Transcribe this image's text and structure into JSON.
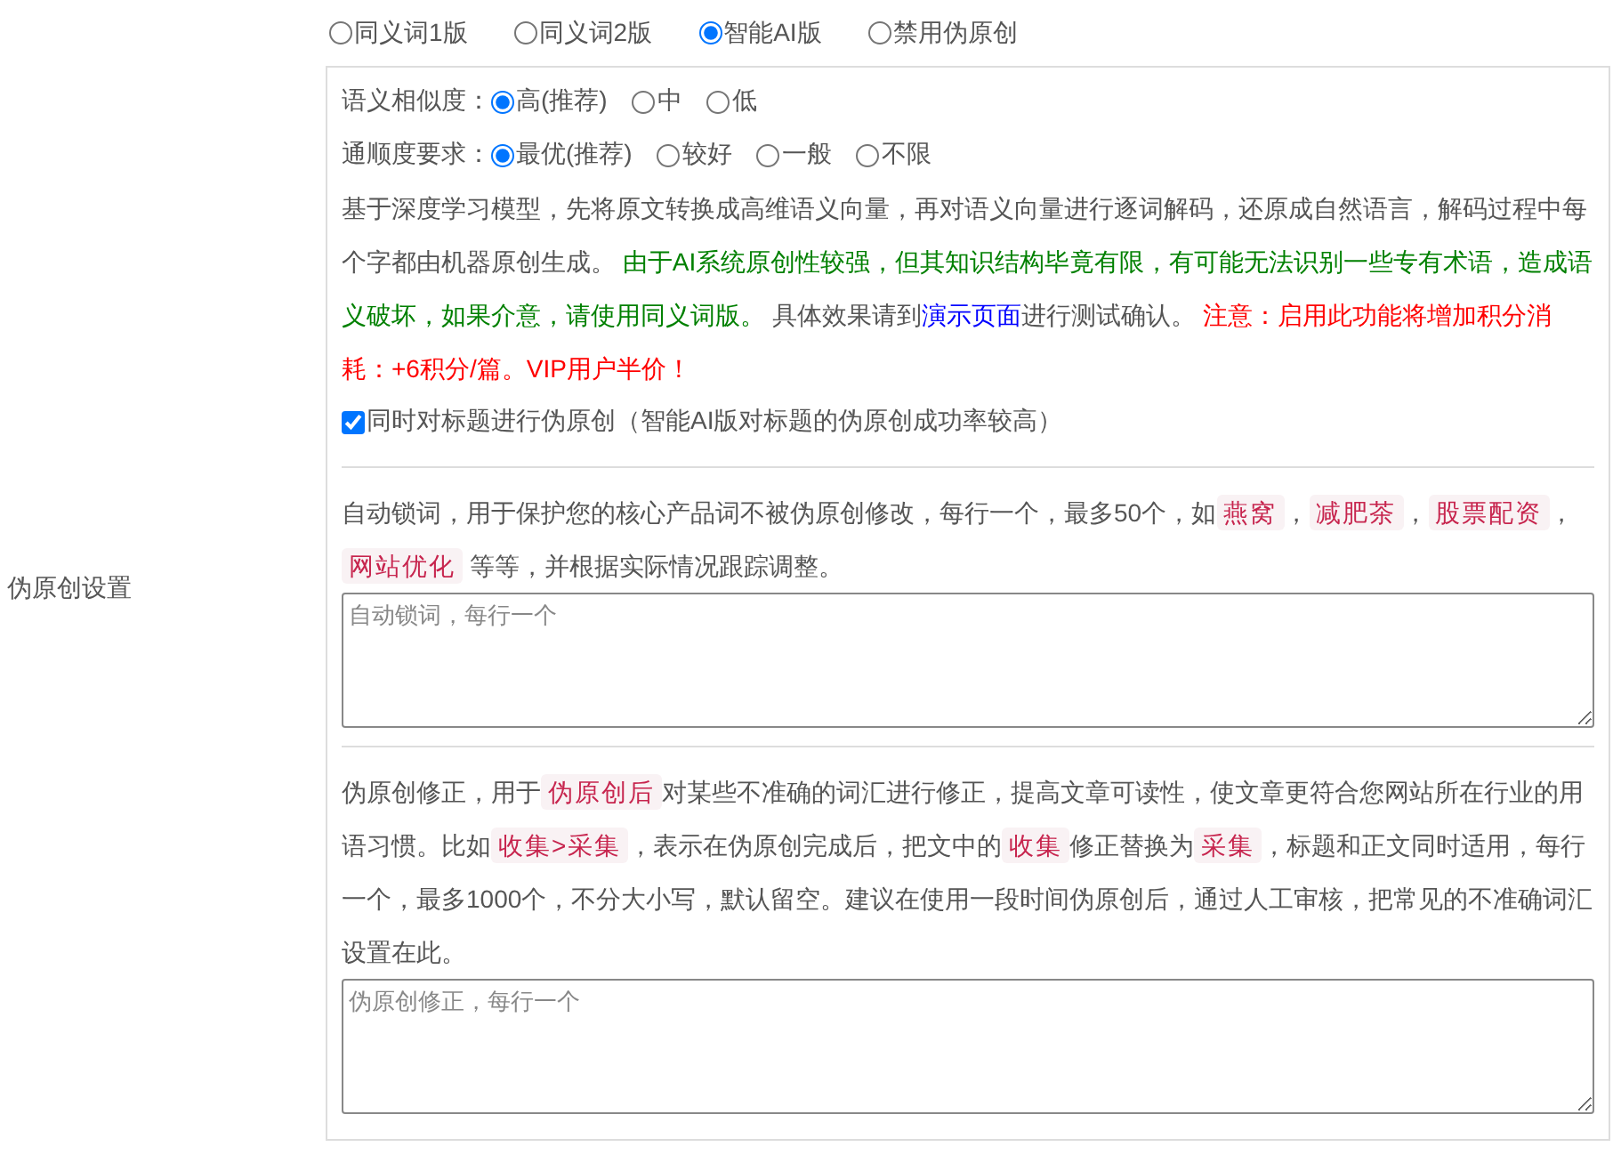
{
  "sidebar_label": "伪原创设置",
  "modes": [
    {
      "label": "同义词1版",
      "selected": false
    },
    {
      "label": "同义词2版",
      "selected": false
    },
    {
      "label": "智能AI版",
      "selected": true
    },
    {
      "label": "禁用伪原创",
      "selected": false
    }
  ],
  "similarity": {
    "label": "语义相似度：",
    "options": [
      {
        "label": "高(推荐)",
        "selected": true
      },
      {
        "label": "中",
        "selected": false
      },
      {
        "label": "低",
        "selected": false
      }
    ]
  },
  "fluency": {
    "label": "通顺度要求：",
    "options": [
      {
        "label": "最优(推荐)",
        "selected": true
      },
      {
        "label": "较好",
        "selected": false
      },
      {
        "label": "一般",
        "selected": false
      },
      {
        "label": "不限",
        "selected": false
      }
    ]
  },
  "ai_description": [
    {
      "kind": "text",
      "text": "基于深度学习模型，先将原文转换成高维语义向量，再对语义向量进行逐词解码，还原成自然语言，解码过程中每个字都由机器原创生成。 "
    },
    {
      "kind": "green",
      "text": "由于AI系统原创性较强，但其知识结构毕竟有限，有可能无法识别一些专有术语，造成语义破坏，如果介意，请使用同义词版。"
    },
    {
      "kind": "text",
      "text": " 具体效果请到"
    },
    {
      "kind": "link",
      "text": "演示页面"
    },
    {
      "kind": "text",
      "text": "进行测试确认。 "
    },
    {
      "kind": "warn",
      "text": "注意：启用此功能将增加积分消耗：+6积分/篇。VIP用户半价！"
    }
  ],
  "title_option": {
    "label": "同时对标题进行伪原创（智能AI版对标题的伪原创成功率较高）",
    "checked": true
  },
  "lock_words": {
    "description": [
      {
        "kind": "text",
        "text": "自动锁词，用于保护您的核心产品词不被伪原创修改，每行一个，最多50个，如"
      },
      {
        "kind": "tag",
        "text": "燕窝"
      },
      {
        "kind": "text",
        "text": "，"
      },
      {
        "kind": "tag",
        "text": "减肥茶"
      },
      {
        "kind": "text",
        "text": "，"
      },
      {
        "kind": "tag",
        "text": "股票配资"
      },
      {
        "kind": "text",
        "text": "，"
      },
      {
        "kind": "tag",
        "text": "网站优化"
      },
      {
        "kind": "text",
        "text": " 等等，并根据实际情况跟踪调整。"
      }
    ],
    "placeholder": "自动锁词，每行一个"
  },
  "correction": {
    "description": [
      {
        "kind": "text",
        "text": "伪原创修正，用于"
      },
      {
        "kind": "tag",
        "text": "伪原创后"
      },
      {
        "kind": "text",
        "text": "对某些不准确的词汇进行修正，提高文章可读性，使文章更符合您网站所在行业的用语习惯。比如"
      },
      {
        "kind": "tag",
        "text": "收集>采集"
      },
      {
        "kind": "text",
        "text": "，表示在伪原创完成后，把文中的"
      },
      {
        "kind": "tag",
        "text": "收集"
      },
      {
        "kind": "text",
        "text": "修正替换为"
      },
      {
        "kind": "tag",
        "text": "采集"
      },
      {
        "kind": "text",
        "text": "，标题和正文同时适用，每行一个，最多1000个，不分大小写，默认留空。建议在使用一段时间伪原创后，通过人工审核，把常见的不准确词汇设置在此。"
      }
    ],
    "placeholder": "伪原创修正，每行一个"
  }
}
